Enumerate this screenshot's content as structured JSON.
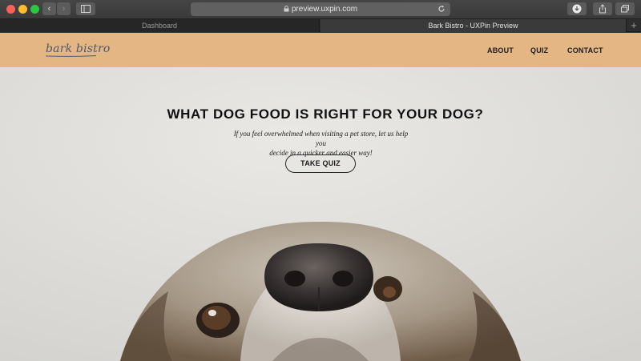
{
  "browser": {
    "url": "preview.uxpin.com",
    "tabs": [
      {
        "label": "Dashboard",
        "active": false
      },
      {
        "label": "Bark Bistro - UXPin Preview",
        "active": true
      }
    ],
    "new_tab_label": "+",
    "back_glyph": "‹",
    "forward_glyph": "›",
    "icons": [
      "back-arrow-icon",
      "forward-arrow-icon",
      "sidebar-icon",
      "lock-icon",
      "reload-icon",
      "download-icon",
      "share-icon",
      "tabs-overview-icon",
      "plus-icon"
    ]
  },
  "site": {
    "logo": "bark bistro",
    "nav": {
      "about": "ABOUT",
      "quiz": "QUIZ",
      "contact": "CONTACT"
    }
  },
  "hero": {
    "title": "WHAT DOG FOOD IS RIGHT FOR YOUR DOG?",
    "subtitle_line1": "If you feel overwhelmed when visiting a pet store, let us help you",
    "subtitle_line2": "decide in a quicker and easier way!",
    "cta": "TAKE QUIZ"
  },
  "colors": {
    "header_bg": "#e4b683",
    "logo_text": "#4c5a6e",
    "hero_bg": "#e0dfdc",
    "chrome_bg": "#3f3f3f"
  }
}
